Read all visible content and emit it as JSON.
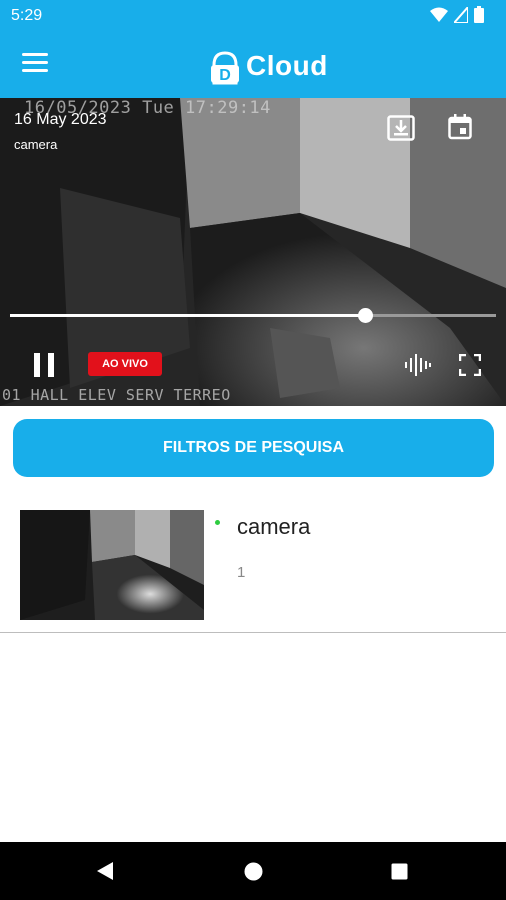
{
  "status_bar": {
    "time": "5:29"
  },
  "app_bar": {
    "brand_letter": "D",
    "brand_name": "Cloud"
  },
  "player": {
    "date": "16 May 2023",
    "camera": "camera",
    "osd_timestamp": "16/05/2023 Tue 17:29:14",
    "osd_label": "01 HALL ELEV SERV TERREO",
    "live_badge": "AO VIVO",
    "progress": 0.73
  },
  "filter_button": {
    "label": "FILTROS DE PESQUISA"
  },
  "camera_list": [
    {
      "name": "camera",
      "number": "1",
      "online": true
    }
  ],
  "colors": {
    "primary": "#18aeea",
    "live": "#e2111b",
    "online": "#2ecc40"
  }
}
